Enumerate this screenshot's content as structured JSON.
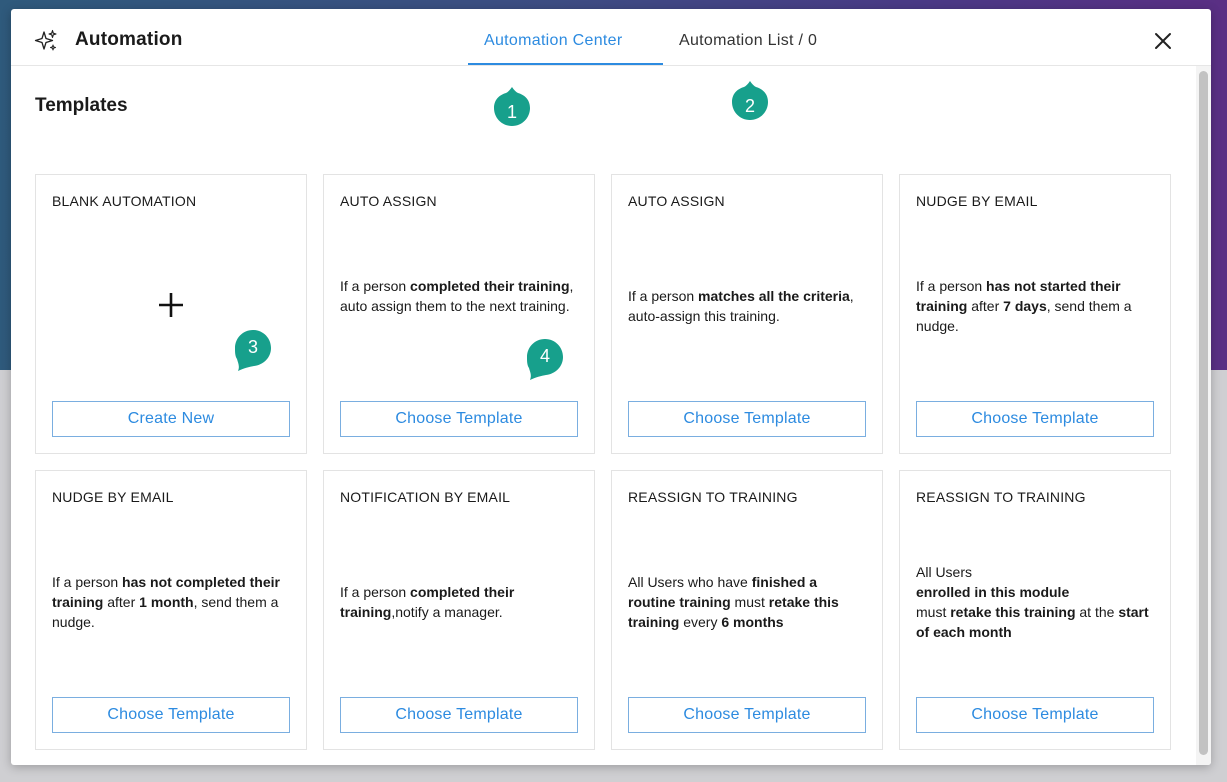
{
  "header": {
    "title": "Automation",
    "tabs": [
      {
        "label": "Automation Center",
        "active": true
      },
      {
        "label": "Automation List / 0",
        "active": false
      }
    ]
  },
  "section": {
    "title": "Templates"
  },
  "cards": [
    {
      "title": "BLANK AUTOMATION",
      "button": "Create New"
    },
    {
      "title": "AUTO ASSIGN",
      "desc": [
        [
          "If a person ",
          false
        ],
        [
          "completed their training",
          true
        ],
        [
          ", auto assign them to the next training.",
          false
        ]
      ],
      "button": "Choose Template"
    },
    {
      "title": "AUTO ASSIGN",
      "desc": [
        [
          "If a person ",
          false
        ],
        [
          "matches all the criteria",
          true
        ],
        [
          ", auto-assign this training.",
          false
        ]
      ],
      "button": "Choose Template"
    },
    {
      "title": "NUDGE BY EMAIL",
      "desc": [
        [
          "If a person ",
          false
        ],
        [
          "has not started their training",
          true
        ],
        [
          " after ",
          false
        ],
        [
          "7 days",
          true
        ],
        [
          ", send them a nudge.",
          false
        ]
      ],
      "button": "Choose Template"
    },
    {
      "title": "NUDGE BY EMAIL",
      "desc": [
        [
          "If a person ",
          false
        ],
        [
          "has not completed their training",
          true
        ],
        [
          " after ",
          false
        ],
        [
          "1 month",
          true
        ],
        [
          ", send them a nudge.",
          false
        ]
      ],
      "button": "Choose Template"
    },
    {
      "title": "NOTIFICATION BY EMAIL",
      "desc": [
        [
          "If a person ",
          false
        ],
        [
          "completed their training",
          true
        ],
        [
          ",notify a manager.",
          false
        ]
      ],
      "button": "Choose Template"
    },
    {
      "title": "REASSIGN TO TRAINING",
      "desc": [
        [
          "All Users who have ",
          false
        ],
        [
          "finished a routine training",
          true
        ],
        [
          " must ",
          false
        ],
        [
          "retake this training",
          true
        ],
        [
          " every ",
          false
        ],
        [
          "6 months",
          true
        ]
      ],
      "button": "Choose Template"
    },
    {
      "title": "REASSIGN TO TRAINING",
      "desc": [
        [
          "All Users",
          false
        ],
        [
          "\n",
          false
        ],
        [
          "enrolled in this module",
          true
        ],
        [
          "\n",
          false
        ],
        [
          "must ",
          false
        ],
        [
          "retake this training",
          true
        ],
        [
          " at the ",
          false
        ],
        [
          "start of each month",
          true
        ]
      ],
      "button": "Choose Template"
    }
  ],
  "markers": [
    "1",
    "2",
    "3",
    "4"
  ],
  "colors": {
    "accent": "#2d8be0",
    "marker": "#17a08c"
  },
  "icons": {
    "app": "sparkle-icon",
    "close": "close-icon",
    "blank": "plus-icon",
    "marker": "marker-pin-icon"
  }
}
